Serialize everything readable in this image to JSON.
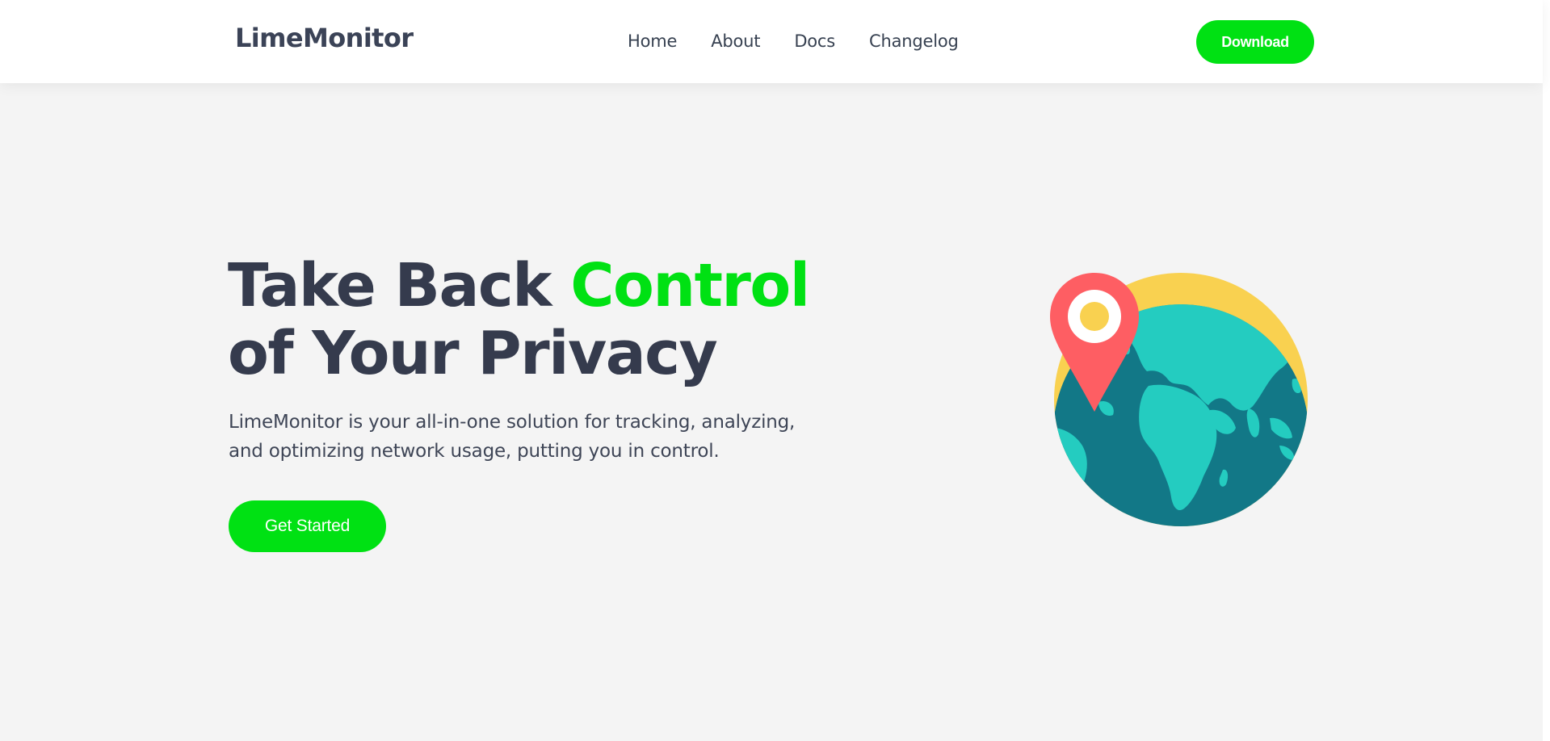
{
  "header": {
    "logo": "LimeMonitor",
    "nav": [
      "Home",
      "About",
      "Docs",
      "Changelog"
    ],
    "download_label": "Download"
  },
  "hero": {
    "title_part1": "Take Back ",
    "title_accent": "Control",
    "title_line2": "of Your Privacy",
    "subtitle_line1": "LimeMonitor is your all-in-one solution for tracking, analyzing,",
    "subtitle_line2": "and optimizing network usage, putting you in control.",
    "cta_label": "Get Started"
  },
  "illustration": {
    "icons": [
      "globe-icon",
      "location-pin-icon"
    ]
  },
  "colors": {
    "accent": "#00e113",
    "text_dark": "#353b4d",
    "background": "#f4f4f4",
    "globe_sun": "#f9d150",
    "globe_ocean": "#127887",
    "globe_land": "#24ccc0",
    "pin": "#fe5e63"
  }
}
